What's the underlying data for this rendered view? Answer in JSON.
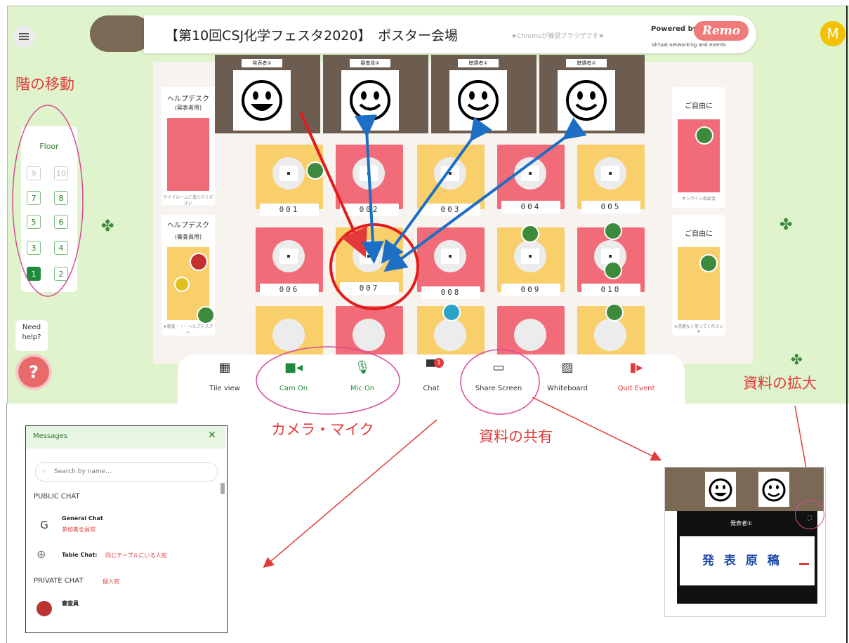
{
  "header": {
    "event_title": "【第10回CSJ化学フェスタ2020】　ポスター会場",
    "browser_note": "★Chromeが推奨ブラウザです★",
    "powered_by": "Powered by",
    "remo_logo": "Remo",
    "remo_tagline": "Virtual networking and events",
    "user_initial": "M"
  },
  "annotations": {
    "floor_move": "階の移動",
    "cam_mic": "カメラ・マイク",
    "share": "資料の共有",
    "enlarge": "資料の拡大"
  },
  "floor_panel": {
    "title": "Floor",
    "floors": [
      "9",
      "10",
      "7",
      "8",
      "5",
      "6",
      "3",
      "4",
      "1",
      "2"
    ],
    "active_floor": "1"
  },
  "help": {
    "bubble": "Need help?",
    "icon_char": "?"
  },
  "side_rooms": {
    "left_top_title_1": "ヘルプデスク",
    "left_top_title_2": "(発表者用)",
    "left_top_note": "サイドルームに進んでください",
    "left_bottom_title_1": "ヘルプデスク",
    "left_bottom_title_2": "(審査員用)",
    "left_bottom_note": "★審査・・・ヘルプデスクへ",
    "right_top_title": "ご自由に",
    "right_top_note": "オンライン商談会",
    "right_bottom_title": "ご自由に",
    "right_bottom_note": "★遠慮なく使ってください★"
  },
  "video_feeds": [
    {
      "plate": "発表者①"
    },
    {
      "plate": "審査員①"
    },
    {
      "plate": "聴講者①"
    },
    {
      "plate": "聴講者②"
    }
  ],
  "tables": [
    "001",
    "002",
    "003",
    "004",
    "005",
    "006",
    "007",
    "008",
    "009",
    "010"
  ],
  "toolbar": {
    "tile_view": "Tile view",
    "cam_on": "Cam On",
    "mic_on": "Mic On",
    "chat": "Chat",
    "chat_badge": "1",
    "share_screen": "Share Screen",
    "whiteboard": "Whiteboard",
    "quit_event": "Quit Event"
  },
  "messages": {
    "title": "Messages",
    "close": "✕",
    "search_placeholder": "Search by name...",
    "public_chat": "PUBLIC CHAT",
    "general_chat": "General Chat",
    "general_chat_note": "参加者全員宛",
    "general_initial": "G",
    "table_chat": "Table Chat:",
    "table_chat_note": "同じテーブルにいる人宛",
    "private_chat": "PRIVATE CHAT",
    "private_chat_note": "個人宛",
    "private_contact": "審査員"
  },
  "preview": {
    "presenter_plate": "発表者①",
    "manuscript": "発 表 原 稿"
  },
  "colors": {
    "brand_green": "#1f8a3c",
    "annotation_red": "#e23a3a",
    "arrow_blue": "#1c6fc4",
    "remo_pink": "#f07a7a",
    "table_pink": "#f26b78",
    "table_yellow": "#f9cf6c"
  }
}
